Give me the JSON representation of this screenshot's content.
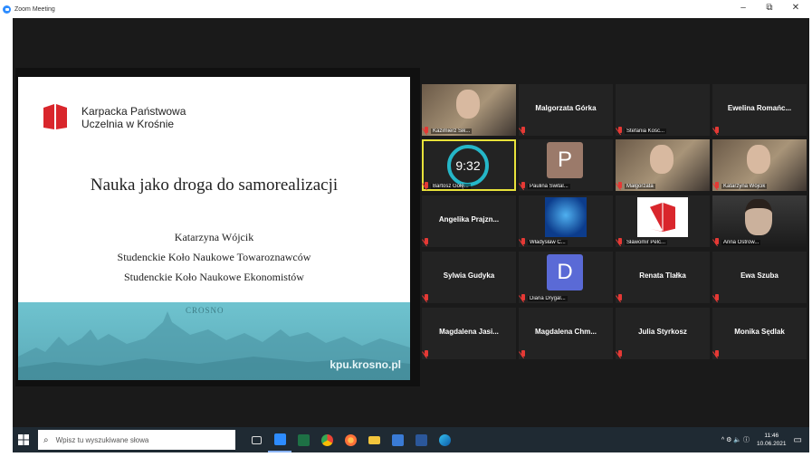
{
  "window": {
    "title": "Zoom Meeting",
    "minimize": "–",
    "maximize": "⧉",
    "close": "✕"
  },
  "slide": {
    "logo_line1": "Karpacka Państwowa",
    "logo_line2": "Uczelnia w Krośnie",
    "title": "Nauka jako droga do samorealizacji",
    "author": "Katarzyna Wójcik",
    "line2": "Studenckie Koło Naukowe Towaroznawców",
    "line3": "Studenckie Koło Naukowe Ekonomistów",
    "banner_text": "CROSNO",
    "url": "kpu.krosno.pl"
  },
  "colors": {
    "accent": "#2d8cff",
    "speaker_outline": "#e8e23a",
    "muted_red": "#e53935",
    "logo_red": "#d9262c",
    "timer_ring": "#25b7c8"
  },
  "participants": [
    {
      "label": "Kazimierz Sik...",
      "kind": "video"
    },
    {
      "name": "Malgorzata Górka",
      "kind": "name"
    },
    {
      "label": "Stefania Kośc...",
      "kind": "blank"
    },
    {
      "name": "Ewelina Romańc...",
      "kind": "name"
    },
    {
      "label": "Bartosz Gołę...",
      "kind": "timer",
      "timer": "9:32"
    },
    {
      "label": "Paulina Śwital...",
      "kind": "avatar",
      "initial": "P",
      "color": "#9b7a6a"
    },
    {
      "label": "Małgorzata",
      "kind": "video"
    },
    {
      "label": "Katarzyna Wójcik",
      "kind": "video"
    },
    {
      "name": "Angelika Prajzn...",
      "kind": "name"
    },
    {
      "label": "Władysław C...",
      "kind": "image"
    },
    {
      "label": "Sławomir Pelc...",
      "kind": "logo"
    },
    {
      "label": "Anna Ostrow...",
      "kind": "photo"
    },
    {
      "name": "Sylwia Gudyka",
      "kind": "name"
    },
    {
      "label": "Diana Drygal...",
      "kind": "avatar",
      "initial": "D",
      "color": "#5a6ad6"
    },
    {
      "name": "Renata Tlałka",
      "kind": "name"
    },
    {
      "name": "Ewa Szuba",
      "kind": "name"
    },
    {
      "name": "Magdalena Jasi...",
      "kind": "name"
    },
    {
      "name": "Magdalena Chm...",
      "kind": "name"
    },
    {
      "name": "Julia Styrkosz",
      "kind": "name"
    },
    {
      "name": "Monika Sędlak",
      "kind": "name"
    }
  ],
  "taskbar": {
    "search_placeholder": "Wpisz tu wyszukiwane słowa",
    "time": "11:46",
    "date": "10.06.2021",
    "tray_symbols": "^ ⚙ 🔈 ⓘ"
  }
}
